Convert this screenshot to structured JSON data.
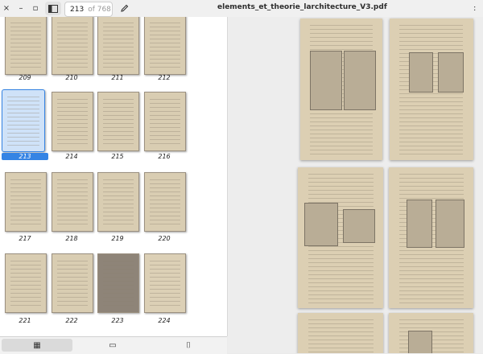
{
  "toolbar": {
    "close_glyph": "×",
    "minimize_glyph": "–",
    "maximize_glyph": "▫",
    "current_page": "213",
    "page_total": "of 768",
    "title": "elements_et_theorie_larchitecture_V3.pdf",
    "right_glyph": ":",
    "icons": [
      "sidebar-icon",
      "pencil-icon"
    ]
  },
  "thumbnails": [
    {
      "label": "209"
    },
    {
      "label": "210"
    },
    {
      "label": "211"
    },
    {
      "label": "212"
    },
    {
      "label": "213",
      "selected": true
    },
    {
      "label": "214"
    },
    {
      "label": "215"
    },
    {
      "label": "216"
    },
    {
      "label": "217"
    },
    {
      "label": "218"
    },
    {
      "label": "219"
    },
    {
      "label": "220"
    },
    {
      "label": "221"
    },
    {
      "label": "222"
    },
    {
      "label": "223"
    },
    {
      "label": "224"
    }
  ],
  "sidebar_tabs": [
    {
      "icon": "grid-icon",
      "glyph": "▦"
    },
    {
      "icon": "comment-icon",
      "glyph": "▭"
    },
    {
      "icon": "bookmark-icon",
      "glyph": "⌷"
    }
  ],
  "colors": {
    "accent": "#3584e4",
    "paper": "#dccfb3"
  }
}
